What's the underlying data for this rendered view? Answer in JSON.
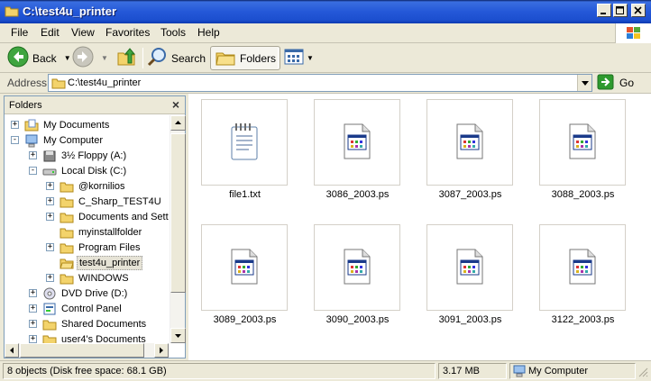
{
  "window": {
    "title": "C:\\test4u_printer"
  },
  "menu": [
    "File",
    "Edit",
    "View",
    "Favorites",
    "Tools",
    "Help"
  ],
  "toolbar": {
    "back_label": "Back",
    "search_label": "Search",
    "folders_label": "Folders"
  },
  "address": {
    "label": "Address",
    "value": "C:\\test4u_printer",
    "go_label": "Go"
  },
  "folders_pane": {
    "title": "Folders",
    "tree": [
      {
        "label": "My Documents",
        "expander": "+",
        "icon": "my-documents-icon"
      },
      {
        "label": "My Computer",
        "expander": "-",
        "icon": "my-computer-icon"
      },
      {
        "label": "3½ Floppy (A:)",
        "expander": "+",
        "icon": "floppy-icon"
      },
      {
        "label": "Local Disk (C:)",
        "expander": "-",
        "icon": "disk-icon"
      },
      {
        "label": "@kornilios",
        "expander": "+",
        "icon": "folder-icon"
      },
      {
        "label": "C_Sharp_TEST4U",
        "expander": "+",
        "icon": "folder-icon"
      },
      {
        "label": "Documents and Setti",
        "expander": "+",
        "icon": "folder-icon"
      },
      {
        "label": "myinstallfolder",
        "expander": "",
        "icon": "folder-icon"
      },
      {
        "label": "Program Files",
        "expander": "+",
        "icon": "folder-icon"
      },
      {
        "label": "test4u_printer",
        "expander": "",
        "icon": "folder-open-icon",
        "selected": true
      },
      {
        "label": "WINDOWS",
        "expander": "+",
        "icon": "folder-icon"
      },
      {
        "label": "DVD Drive (D:)",
        "expander": "+",
        "icon": "dvd-icon"
      },
      {
        "label": "Control Panel",
        "expander": "+",
        "icon": "control-panel-icon"
      },
      {
        "label": "Shared Documents",
        "expander": "+",
        "icon": "folder-icon"
      },
      {
        "label": "user4's Documents",
        "expander": "+",
        "icon": "folder-icon"
      }
    ]
  },
  "files": [
    {
      "name": "file1.txt",
      "icon": "notepad-icon"
    },
    {
      "name": "3086_2003.ps",
      "icon": "ps-file-icon"
    },
    {
      "name": "3087_2003.ps",
      "icon": "ps-file-icon"
    },
    {
      "name": "3088_2003.ps",
      "icon": "ps-file-icon"
    },
    {
      "name": "3089_2003.ps",
      "icon": "ps-file-icon"
    },
    {
      "name": "3090_2003.ps",
      "icon": "ps-file-icon"
    },
    {
      "name": "3091_2003.ps",
      "icon": "ps-file-icon"
    },
    {
      "name": "3122_2003.ps",
      "icon": "ps-file-icon"
    }
  ],
  "status": {
    "objects": "8 objects (Disk free space: 68.1 GB)",
    "size": "3.17 MB",
    "location": "My Computer"
  },
  "colors": {
    "titlebar": "#245edb",
    "selection": "#e6e3d6",
    "go_green": "#2e9a2e"
  }
}
